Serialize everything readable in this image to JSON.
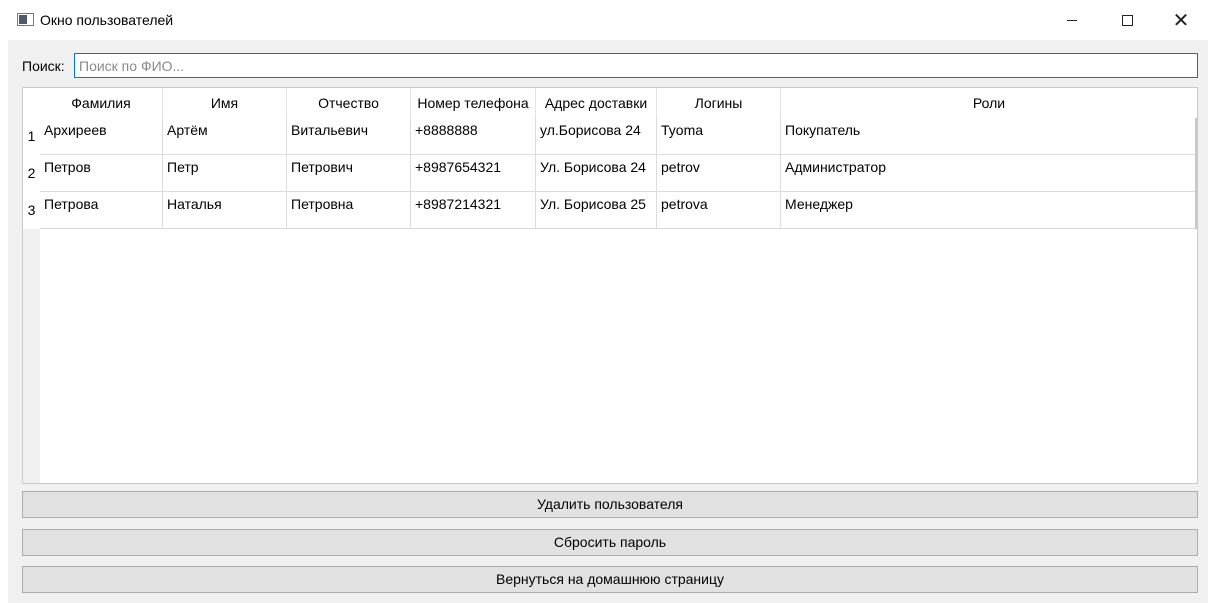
{
  "window": {
    "title": "Окно пользователей",
    "close_glyph": "✕"
  },
  "search": {
    "label": "Поиск:",
    "placeholder": "Поиск по ФИО...",
    "value": ""
  },
  "table": {
    "columns": [
      "Фамилия",
      "Имя",
      "Отчество",
      "Номер телефона",
      "Адрес доставки",
      "Логины",
      "Роли"
    ],
    "rows": [
      {
        "num": "1",
        "cells": [
          "Архиреев",
          "Артём",
          "Витальевич",
          "+8888888",
          "ул.Борисова 24",
          "Tyoma",
          "Покупатель"
        ]
      },
      {
        "num": "2",
        "cells": [
          "Петров",
          "Петр",
          "Петрович",
          "+8987654321",
          "Ул. Борисова 24",
          "petrov",
          "Администратор"
        ]
      },
      {
        "num": "3",
        "cells": [
          "Петрова",
          "Наталья",
          "Петровна",
          "+8987214321",
          "Ул. Борисова 25",
          "petrova",
          "Менеджер"
        ]
      }
    ]
  },
  "buttons": {
    "delete_user": "Удалить пользователя",
    "reset_password": "Сбросить пароль",
    "go_home": "Вернуться на домашнюю страницу"
  },
  "colors": {
    "accent": "#0078d7",
    "button_bg": "#e1e1e1",
    "client_bg": "#f0f0f0"
  }
}
